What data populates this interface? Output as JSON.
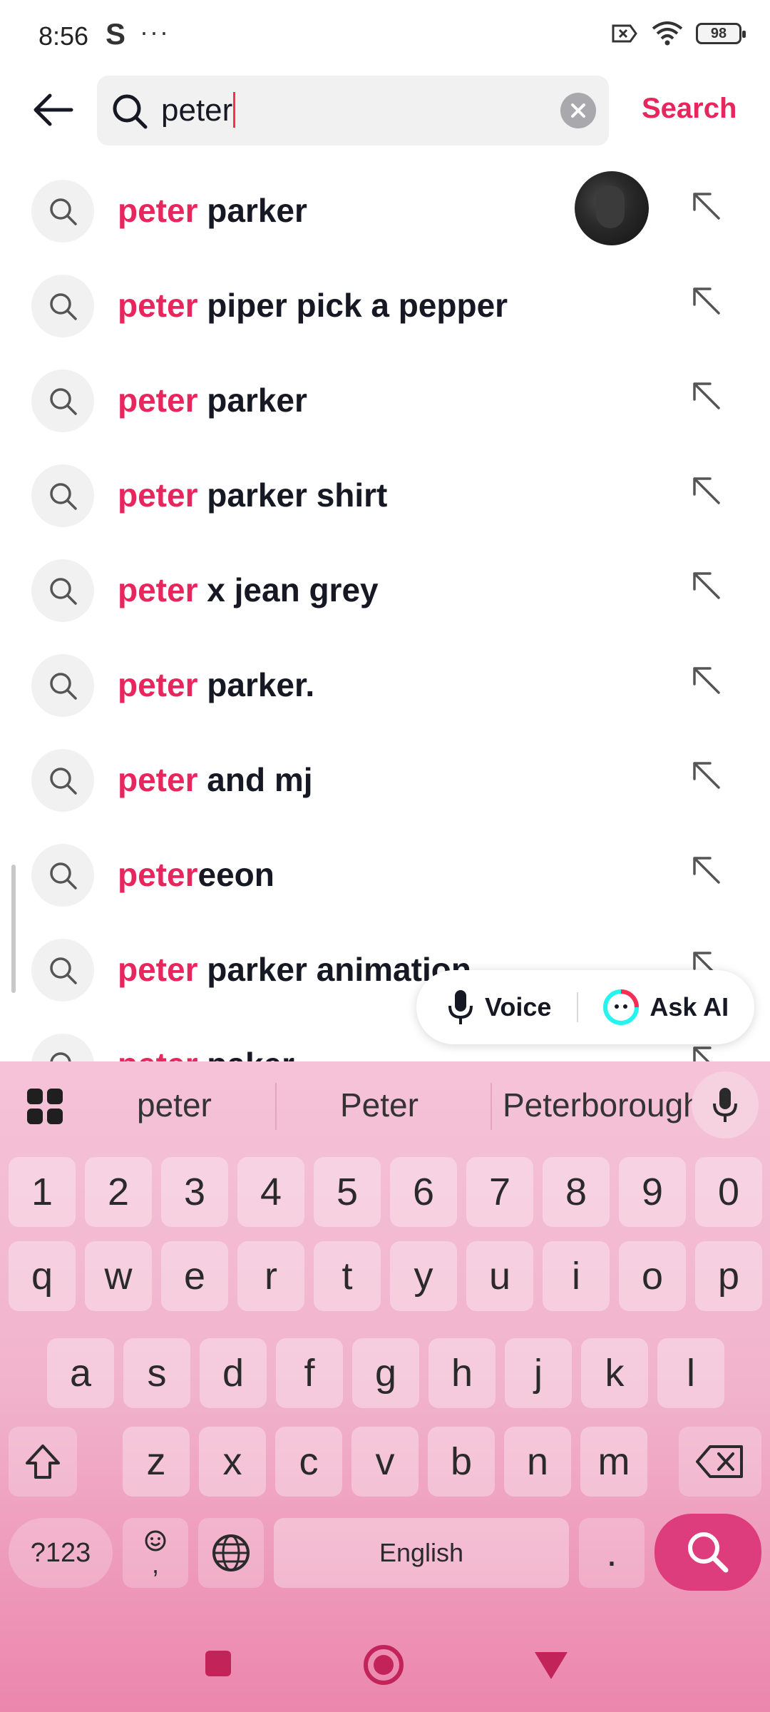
{
  "status": {
    "time": "8:56",
    "app_letter": "S",
    "dots": "···",
    "battery": "98"
  },
  "search": {
    "value": "peter",
    "action_label": "Search"
  },
  "suggestions": [
    {
      "hl": "peter",
      "rest": " parker",
      "thumb": true
    },
    {
      "hl": "peter",
      "rest": " piper pick a pepper"
    },
    {
      "hl": "peter",
      "rest": " parker"
    },
    {
      "hl": "peter",
      "rest": " parker shirt"
    },
    {
      "hl": "peter",
      "rest": " x jean grey"
    },
    {
      "hl": "peter",
      "rest": " parker."
    },
    {
      "hl": "peter",
      "rest": " and mj"
    },
    {
      "hl": "peter",
      "rest": "eeon"
    },
    {
      "hl": "peter",
      "rest": " parker animation"
    },
    {
      "hl": "peter",
      "rest": " paker"
    }
  ],
  "float": {
    "voice_label": "Voice",
    "ask_label": "Ask AI"
  },
  "keyboard": {
    "suggestions": [
      "peter",
      "Peter",
      "Peterborough"
    ],
    "row_numbers": [
      "1",
      "2",
      "3",
      "4",
      "5",
      "6",
      "7",
      "8",
      "9",
      "0"
    ],
    "row1": [
      "q",
      "w",
      "e",
      "r",
      "t",
      "y",
      "u",
      "i",
      "o",
      "p"
    ],
    "row2": [
      "a",
      "s",
      "d",
      "f",
      "g",
      "h",
      "j",
      "k",
      "l"
    ],
    "row3": [
      "z",
      "x",
      "c",
      "v",
      "b",
      "n",
      "m"
    ],
    "symbols_label": "?123",
    "emoji_comma": ",",
    "space_label": "English",
    "period_label": "."
  },
  "colors": {
    "accent": "#e8265e",
    "keyboard_top": "#f5c3d8",
    "keyboard_bottom": "#ec86ac",
    "search_key": "#dd3d7c"
  }
}
